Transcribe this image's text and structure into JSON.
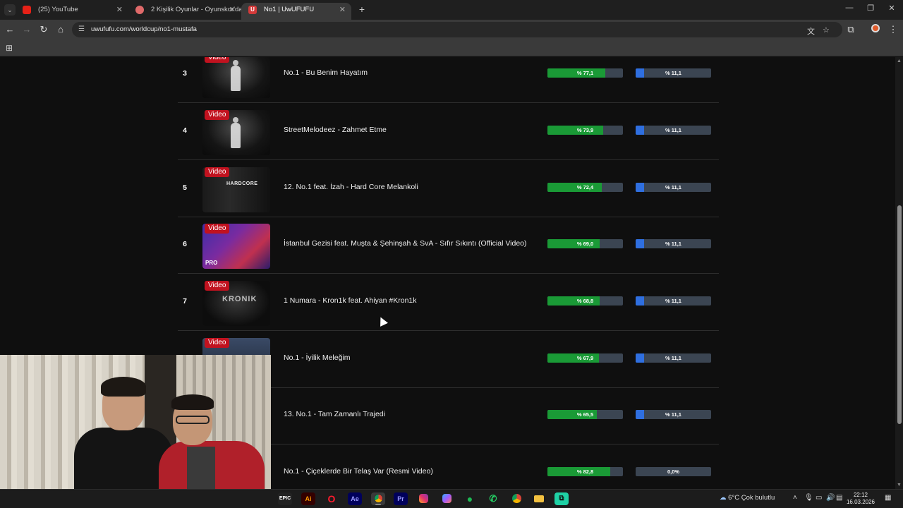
{
  "browser": {
    "tabs": [
      {
        "label": "(25) YouTube",
        "favicon_color": "#e62117",
        "active": false
      },
      {
        "label": "2 Kişilik Oyunlar - Oyunskor'da",
        "favicon_color": "#e06a6a",
        "active": false
      },
      {
        "label": "No1 | UwUFUFU",
        "favicon_color": "#d33a3a",
        "active": true
      }
    ],
    "new_tab": "+",
    "url": "uwufufu.com/worldcup/no1-mustafa",
    "window_controls": {
      "minimize": "—",
      "restore": "❐",
      "close": "✕"
    }
  },
  "rows": [
    {
      "rank": "3",
      "badge": "Video",
      "title": "No.1 - Bu Benim Hayatım",
      "win_pct": 77.1,
      "win_label": "% 77,1",
      "final_pct": 11.1,
      "final_label": "% 11,1",
      "thumb": "dark-figure"
    },
    {
      "rank": "4",
      "badge": "Video",
      "title": "StreetMelodeez - Zahmet Etme",
      "win_pct": 73.9,
      "win_label": "% 73,9",
      "final_pct": 11.1,
      "final_label": "% 11,1",
      "thumb": "dark-figure"
    },
    {
      "rank": "5",
      "badge": "Video",
      "title": "12. No.1 feat. İzah - Hard Core Melankoli",
      "win_pct": 72.4,
      "win_label": "% 72,4",
      "final_pct": 11.1,
      "final_label": "% 11,1",
      "thumb": "hardcore"
    },
    {
      "rank": "6",
      "badge": "Video",
      "title": "İstanbul Gezisi feat. Muşta & Şehinşah & SvA - Sıfır Sıkıntı (Official Video)",
      "win_pct": 69.0,
      "win_label": "% 69,0",
      "final_pct": 11.1,
      "final_label": "% 11,1",
      "thumb": "istanbul",
      "thumb_text": "PRO"
    },
    {
      "rank": "7",
      "badge": "Video",
      "title": "1 Numara - Kron1k feat. Ahiyan #Kron1k",
      "win_pct": 68.8,
      "win_label": "% 68,8",
      "final_pct": 11.1,
      "final_label": "% 11,1",
      "thumb": "kronik"
    },
    {
      "rank": "",
      "badge": "Video",
      "title": "No.1 - İyilik Meleğim",
      "win_pct": 67.9,
      "win_label": "% 67,9",
      "final_pct": 11.1,
      "final_label": "% 11,1",
      "thumb": "blue"
    },
    {
      "rank": "",
      "badge": "",
      "title": "13. No.1 - Tam Zamanlı Trajedi",
      "win_pct": 65.5,
      "win_label": "% 65,5",
      "final_pct": 11.1,
      "final_label": "% 11,1",
      "thumb": "none"
    },
    {
      "rank": "",
      "badge": "",
      "title": "No.1 - Çiçeklerde Bir Telaş Var (Resmi Video)",
      "win_pct": 82.8,
      "win_label": "% 82,8",
      "final_pct": 0,
      "final_label": "0,0%",
      "thumb": "none"
    }
  ],
  "taskbar": {
    "weather": "6°C  Çok bulutlu",
    "time": "22:12",
    "date": "16.03.2026",
    "apps": [
      "epic-games",
      "illustrator",
      "opera",
      "after-effects",
      "chrome",
      "premiere",
      "instagram",
      "copilot",
      "spotify",
      "whatsapp",
      "chrome-profile",
      "file-explorer",
      "capcut"
    ]
  },
  "colors": {
    "win_bar": "#1a9a36",
    "final_bar": "#2f6fe0",
    "bar_track": "#3b4552",
    "badge": "#c1121f"
  }
}
